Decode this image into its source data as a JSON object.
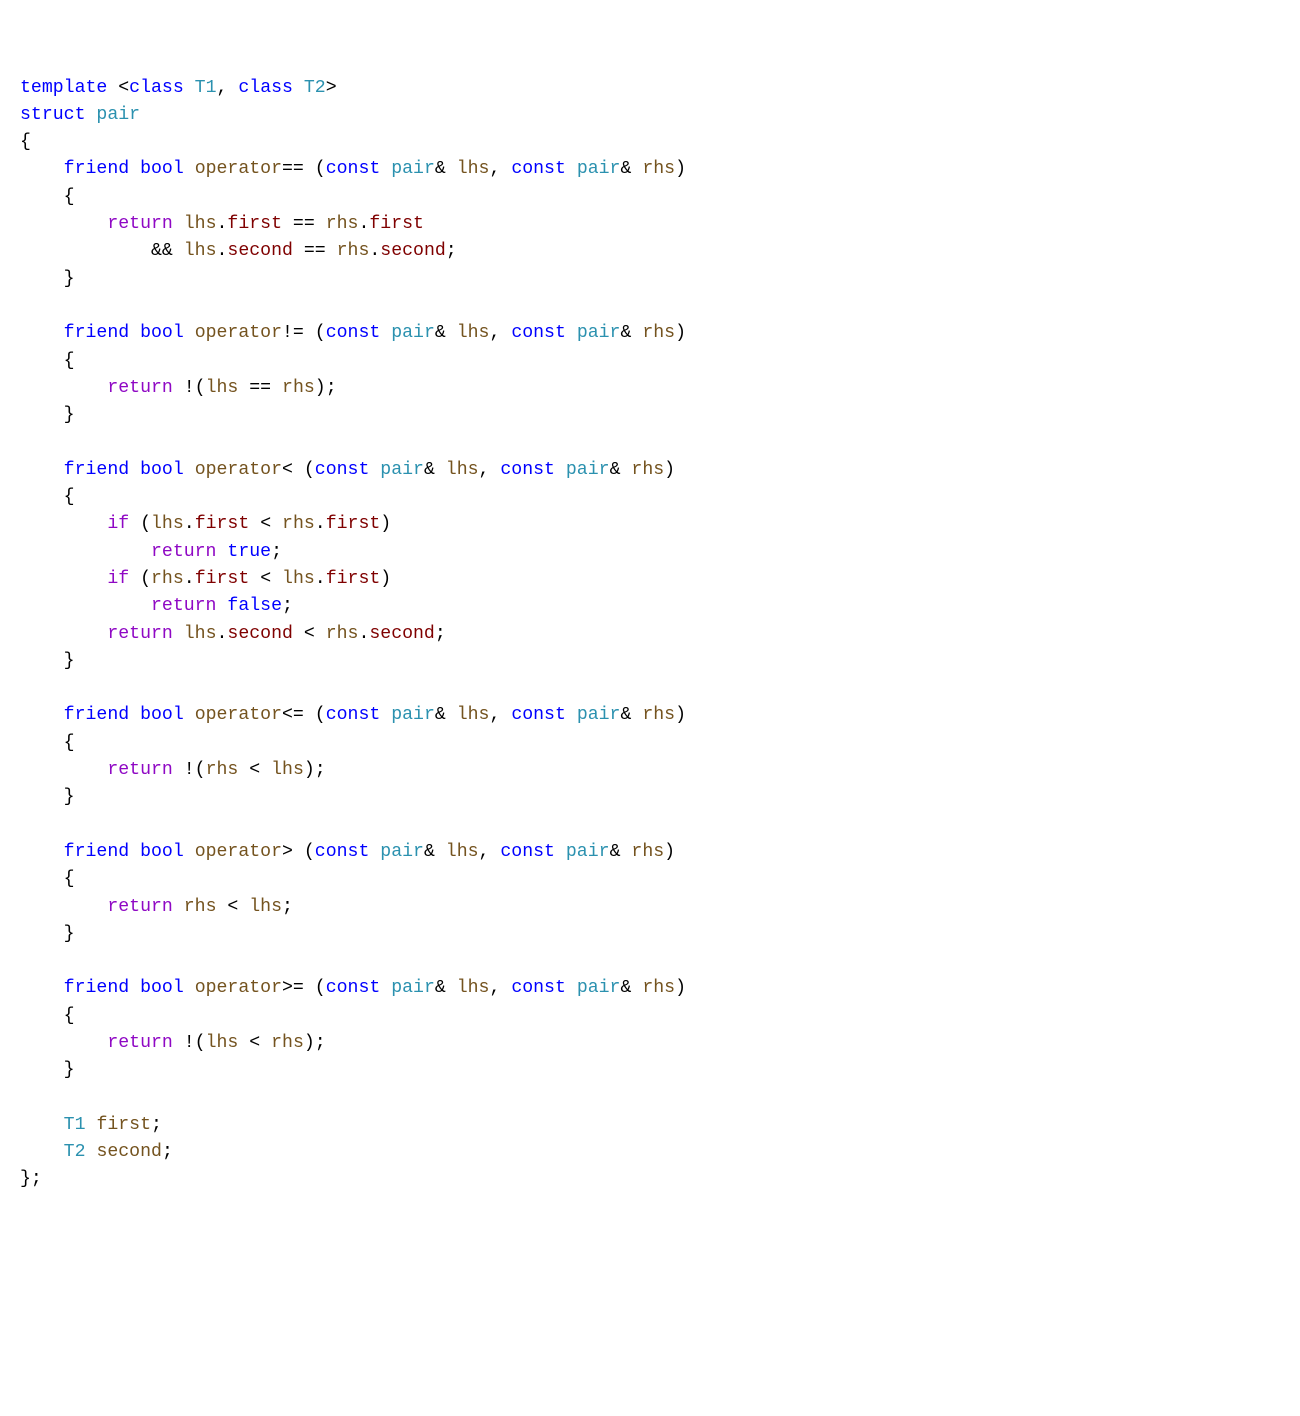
{
  "colors": {
    "keyword": "#0000ff",
    "type": "#2b91af",
    "function": "#74531f",
    "control": "#8f08c4",
    "member": "#7f0000",
    "punctuation": "#000000",
    "background": "#ffffff"
  },
  "tokens": {
    "template": "template",
    "class": "class",
    "struct": "struct",
    "friend": "friend",
    "bool": "bool",
    "const": "const",
    "return": "return",
    "if": "if",
    "true": "true",
    "false": "false",
    "T1": "T1",
    "T2": "T2",
    "pair": "pair",
    "opEq": "operator",
    "opNe": "operator",
    "opLt": "operator",
    "opLe": "operator",
    "opGt": "operator",
    "opGe": "operator",
    "symEq": "==",
    "symNe": "!=",
    "symLt": "<",
    "symLe": "<=",
    "symGt": ">",
    "symGe": ">=",
    "lhs": "lhs",
    "rhs": "rhs",
    "first": "first",
    "second": "second"
  },
  "code_plain": "template <class T1, class T2>\nstruct pair\n{\n    friend bool operator== (const pair& lhs, const pair& rhs)\n    {\n        return lhs.first == rhs.first\n            && lhs.second == rhs.second;\n    }\n\n    friend bool operator!= (const pair& lhs, const pair& rhs)\n    {\n        return !(lhs == rhs);\n    }\n\n    friend bool operator< (const pair& lhs, const pair& rhs)\n    {\n        if (lhs.first < rhs.first)\n            return true;\n        if (rhs.first < lhs.first)\n            return false;\n        return lhs.second < rhs.second;\n    }\n\n    friend bool operator<= (const pair& lhs, const pair& rhs)\n    {\n        return !(rhs < lhs);\n    }\n\n    friend bool operator> (const pair& lhs, const pair& rhs)\n    {\n        return rhs < lhs;\n    }\n\n    friend bool operator>= (const pair& lhs, const pair& rhs)\n    {\n        return !(lhs < rhs);\n    }\n\n    T1 first;\n    T2 second;\n};"
}
